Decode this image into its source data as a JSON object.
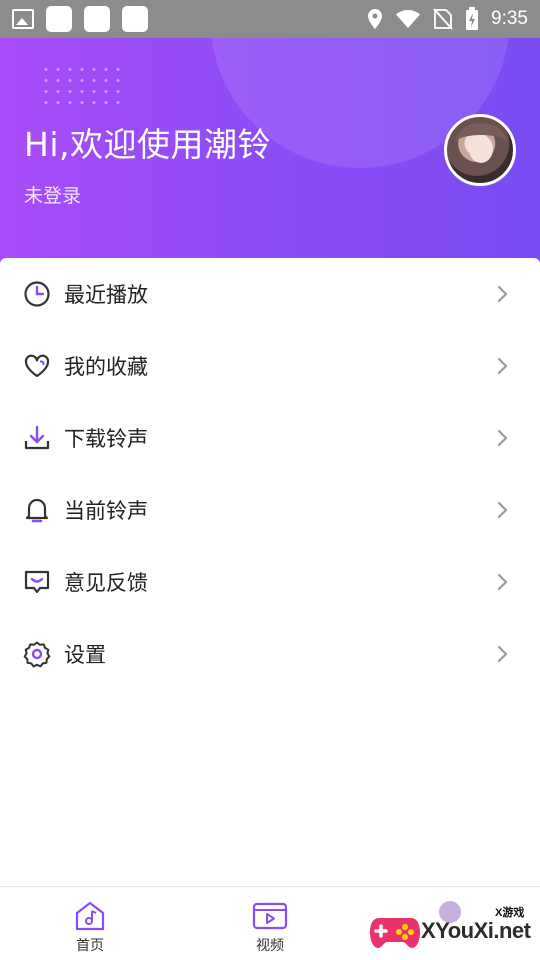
{
  "status_bar": {
    "time": "9:35",
    "left_icons": [
      "image-icon",
      "notification-box-icon",
      "notification-box-icon",
      "notification-box-icon"
    ],
    "right_icons": [
      "location-icon",
      "wifi-icon",
      "no-sim-icon",
      "battery-charging-icon"
    ]
  },
  "header": {
    "greeting": "Hi,欢迎使用潮铃",
    "login_status": "未登录",
    "gradient_colors": [
      "#a74cf8",
      "#7a4cf3"
    ]
  },
  "menu": {
    "items": [
      {
        "label": "最近播放",
        "icon": "clock-icon"
      },
      {
        "label": "我的收藏",
        "icon": "heart-icon"
      },
      {
        "label": "下载铃声",
        "icon": "download-icon"
      },
      {
        "label": "当前铃声",
        "icon": "bell-icon"
      },
      {
        "label": "意见反馈",
        "icon": "feedback-icon"
      },
      {
        "label": "设置",
        "icon": "gear-icon"
      }
    ],
    "accent_color": "#8b4cf6"
  },
  "bottom_nav": {
    "tabs": [
      {
        "label": "首页",
        "icon": "music-home-icon"
      },
      {
        "label": "视频",
        "icon": "video-icon"
      },
      {
        "label": "",
        "icon": "profile-icon"
      }
    ]
  },
  "watermark": {
    "small_text": "X游戏",
    "text": "XYouXi.net"
  }
}
